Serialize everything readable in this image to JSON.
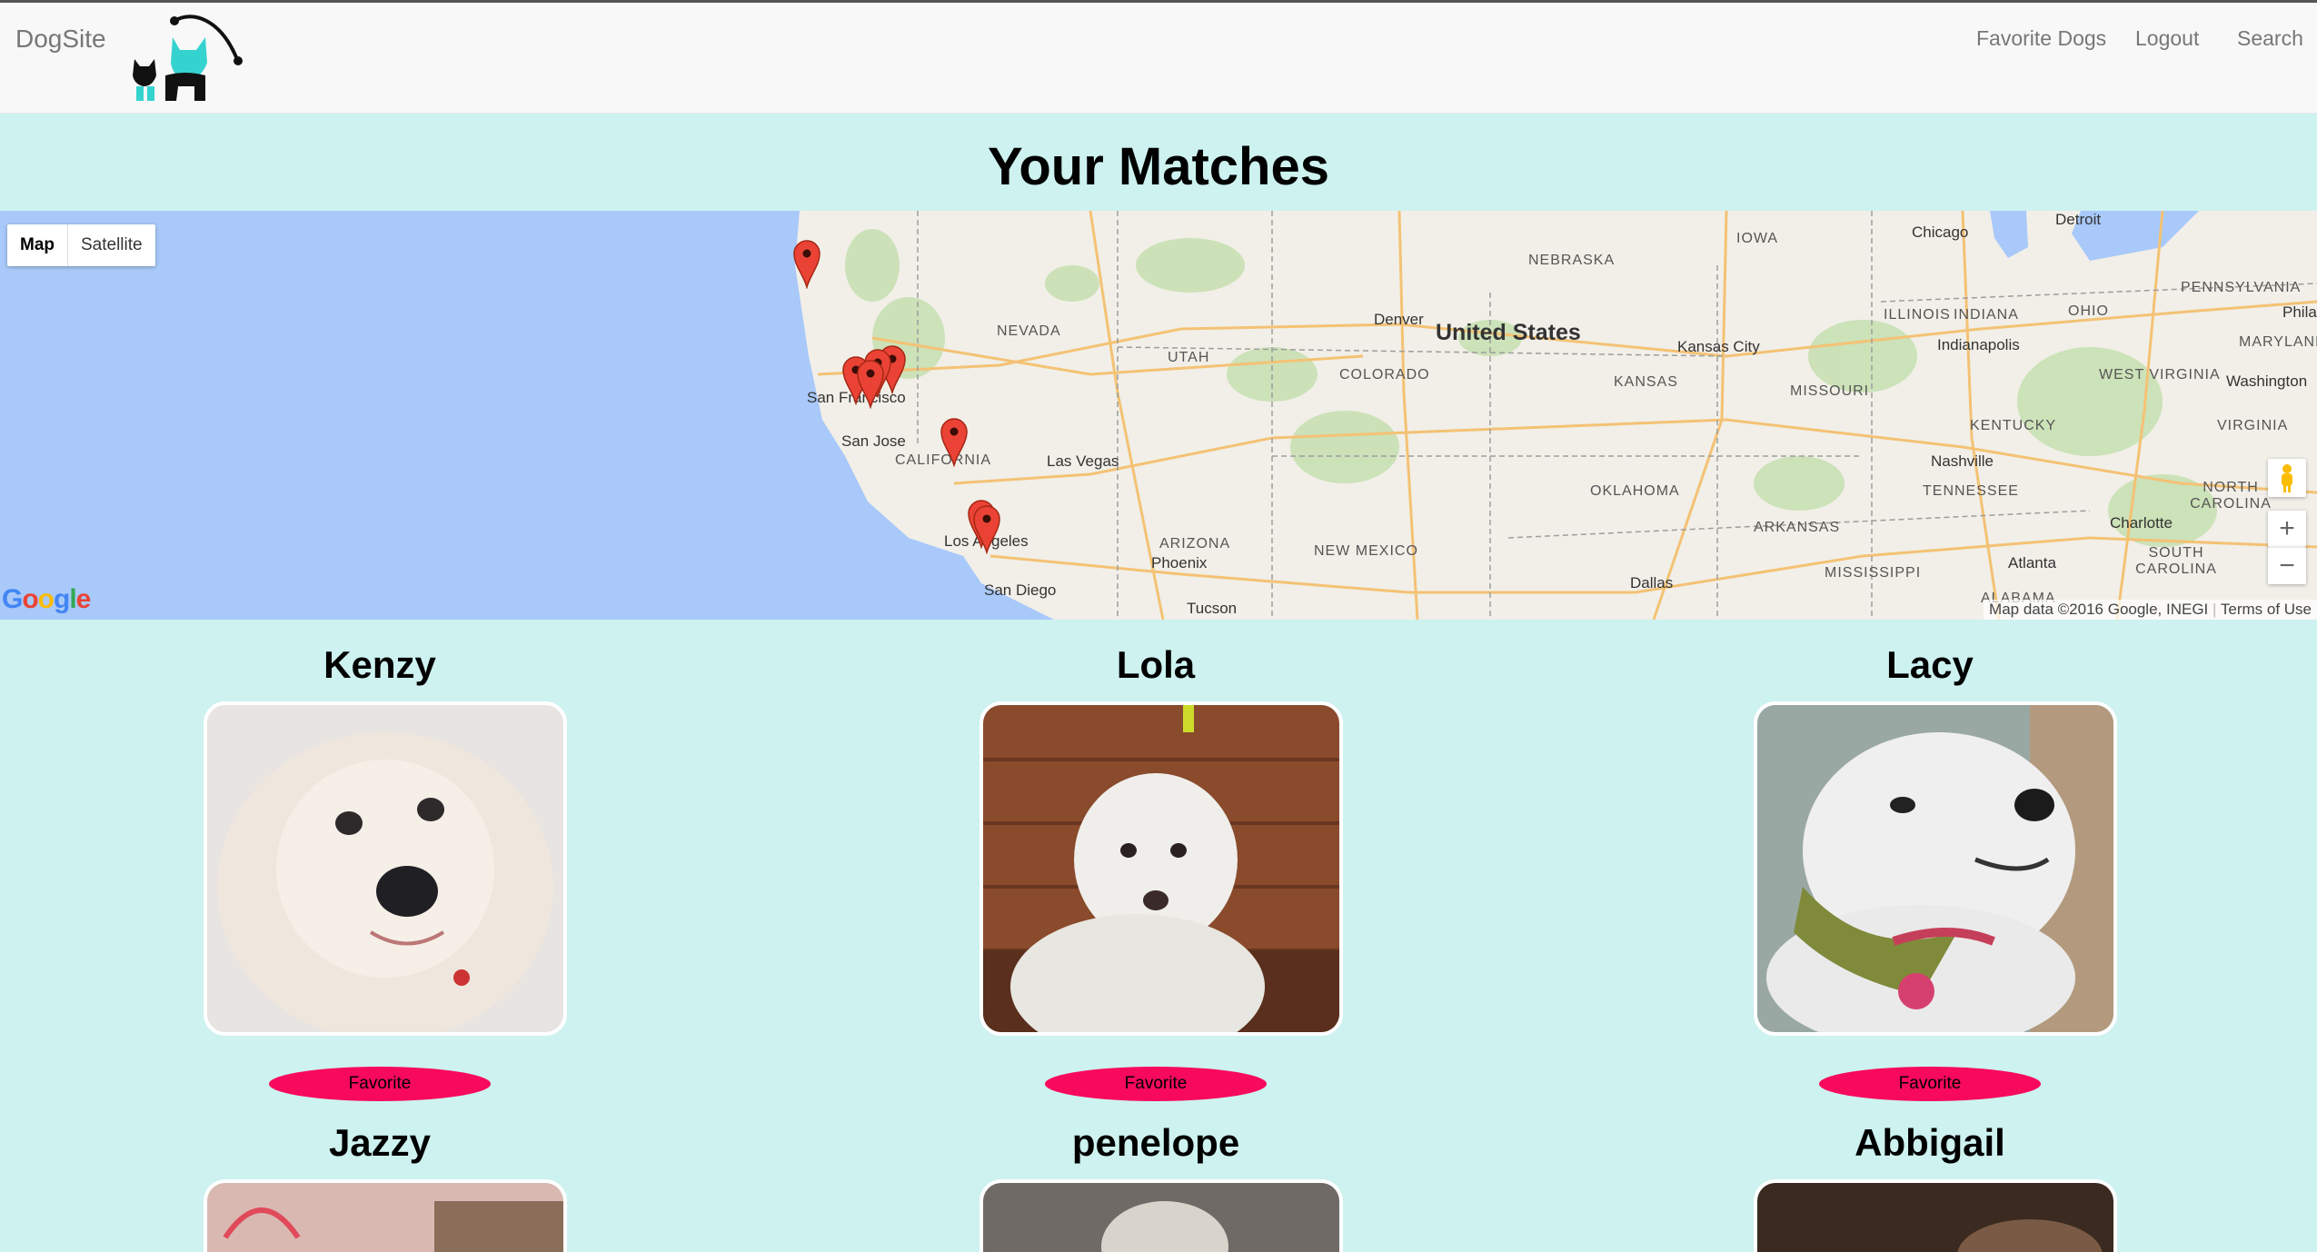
{
  "navbar": {
    "brand": "DogSite",
    "links": [
      "Favorite Dogs",
      "Logout",
      "Search"
    ]
  },
  "page": {
    "title": "Your Matches"
  },
  "map": {
    "type_buttons": [
      "Map",
      "Satellite"
    ],
    "active_type": "Map",
    "zoom_in": "+",
    "zoom_out": "−",
    "attribution": "Map data ©2016 Google, INEGI",
    "terms": "Terms of Use",
    "labels": {
      "country": "United States",
      "states": [
        "NEVADA",
        "UTAH",
        "COLORADO",
        "KANSAS",
        "MISSOURI",
        "NEBRASKA",
        "IOWA",
        "ILLINOIS",
        "INDIANA",
        "OHIO",
        "PENNSYLVANIA",
        "MARYLAND",
        "WEST VIRGINIA",
        "VIRGINIA",
        "KENTUCKY",
        "TENNESSEE",
        "NORTH CAROLINA",
        "SOUTH CAROLINA",
        "ARKANSAS",
        "MISSISSIPPI",
        "ALABAMA",
        "OKLAHOMA",
        "NEW MEXICO",
        "ARIZONA",
        "CALIFORNIA"
      ],
      "cities": [
        "Denver",
        "Chicago",
        "Detroit",
        "Kansas City",
        "Indianapolis",
        "Washington",
        "Nashville",
        "Charlotte",
        "Atlanta",
        "Dallas",
        "Tucson",
        "Phoenix",
        "Las Vegas",
        "San Diego",
        "Los Angeles",
        "San Jose",
        "San Francisco",
        "Philadelphia"
      ]
    },
    "marker_count": 8,
    "colors": {
      "water": "#a8c9f9",
      "land": "#f1efe8",
      "marker": "#e74c3c"
    }
  },
  "dogs": [
    {
      "name": "Kenzy",
      "favorite_label": "Favorite"
    },
    {
      "name": "Lola",
      "favorite_label": "Favorite"
    },
    {
      "name": "Lacy",
      "favorite_label": "Favorite"
    },
    {
      "name": "Jazzy"
    },
    {
      "name": "penelope"
    },
    {
      "name": "Abbigail"
    }
  ],
  "colors": {
    "page_bg": "#cdf2f0",
    "favorite_button": "#f7095c"
  }
}
